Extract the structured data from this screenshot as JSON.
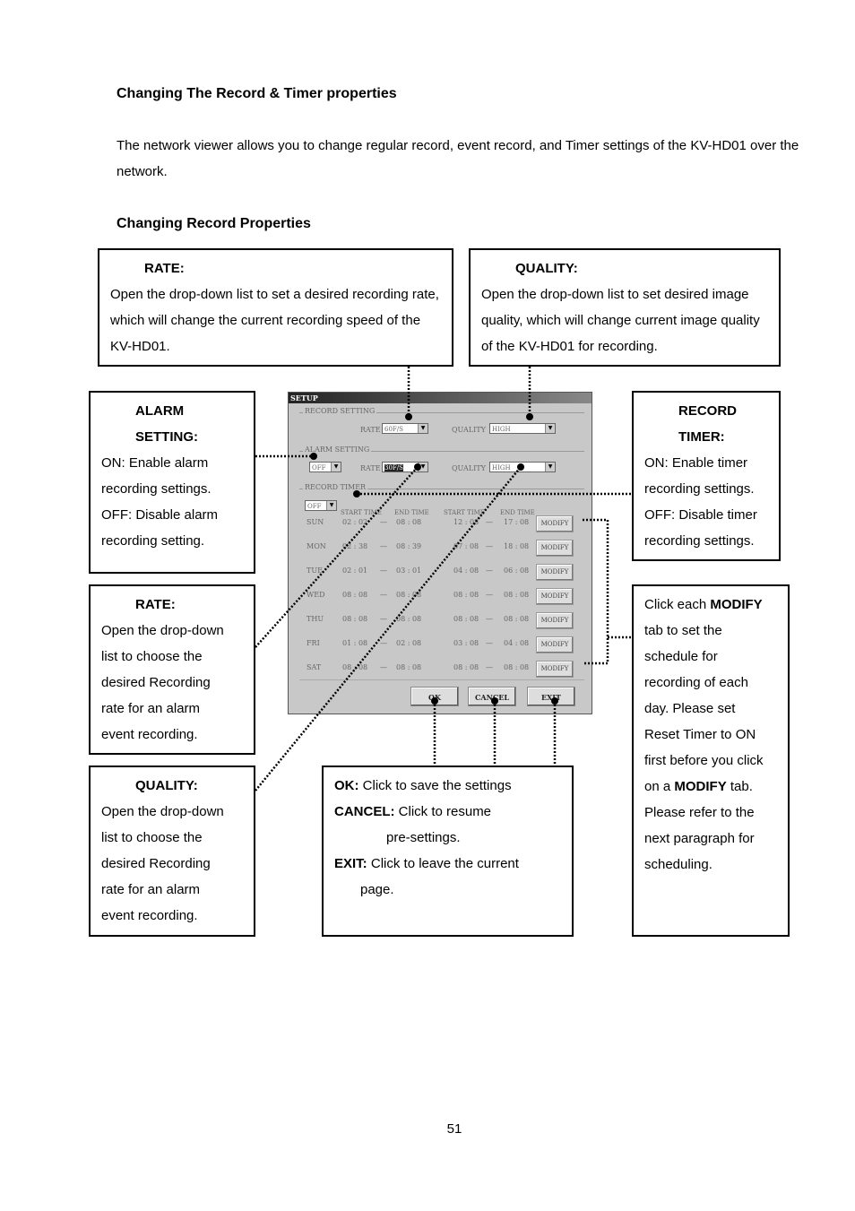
{
  "heading1": "Changing The Record & Timer properties",
  "intro": "The network viewer allows you to change regular record, event record, and Timer settings of the KV-HD01 over the network.",
  "heading2": "Changing Record Properties",
  "callouts": {
    "rate_top": {
      "title": "RATE:",
      "body": "Open the drop-down list to set a desired recording rate, which will change the current recording speed of the KV-HD01."
    },
    "quality_top": {
      "title": "QUALITY:",
      "body": "Open the drop-down list to set desired image quality, which will change current image quality of the KV-HD01 for recording."
    },
    "alarm": {
      "title1": "ALARM",
      "title2": "SETTING:",
      "line1": "ON: Enable alarm",
      "line2": "recording settings.",
      "line3": "OFF: Disable alarm",
      "line4": "recording setting."
    },
    "record_timer": {
      "title1": "RECORD",
      "title2": "TIMER:",
      "line1": "ON: Enable timer",
      "line2": "recording settings.",
      "line3": "OFF: Disable timer",
      "line4": "recording settings."
    },
    "rate_alarm": {
      "title": "RATE:",
      "lines": [
        "Open the drop-down",
        "list to choose the",
        "desired Recording",
        "rate for an alarm",
        "event recording."
      ]
    },
    "quality_alarm": {
      "title": "QUALITY:",
      "lines": [
        "Open the drop-down",
        "list to choose the",
        "desired Recording",
        "rate for an alarm",
        "event recording."
      ]
    },
    "buttons": {
      "ok_key": "OK:",
      "ok_text": " Click to save the settings",
      "cancel_key": "CANCEL:",
      "cancel_text": " Click to resume",
      "cancel_text2": "pre-settings.",
      "exit_key": "EXIT:",
      "exit_text": " Click to leave the current",
      "exit_text2": "page."
    },
    "modify": {
      "l1a": "Click each ",
      "l1b": "MODIFY",
      "l2": "tab to set the",
      "l3": "schedule for",
      "l4": "recording of each",
      "l5": "day. Please set",
      "l6": "Reset Timer to ON",
      "l7": "first before you click",
      "l8a": "on a ",
      "l8b": "MODIFY",
      "l8c": " tab.",
      "l9": "Please refer to the",
      "l10": "next paragraph for",
      "l11": "scheduling."
    }
  },
  "dialog": {
    "title": "SETUP",
    "record_setting": {
      "label": "RECORD SETTING",
      "rate_label": "RATE",
      "rate_value": "60F/S",
      "quality_label": "QUALITY",
      "quality_value": "HIGH"
    },
    "alarm_setting": {
      "label": "ALARM SETTING",
      "state": "OFF",
      "rate_label": "RATE",
      "rate_value": "30F/S",
      "quality_label": "QUALITY",
      "quality_value": "HIGH"
    },
    "record_timer": {
      "label": "RECORD TIMER",
      "state": "OFF",
      "col_start1": "START TIME",
      "col_end1": "END TIME",
      "col_start2": "START TIME",
      "col_end2": "END TIME",
      "modify_label": "MODIFY"
    },
    "schedule": [
      {
        "day": "SUN",
        "s1": "02 : 02",
        "e1": "08 : 08",
        "s2": "12 : 08",
        "e2": "17 : 08"
      },
      {
        "day": "MON",
        "s1": "02 : 38",
        "e1": "08 : 39",
        "s2": "07 : 08",
        "e2": "18 : 08"
      },
      {
        "day": "TUE",
        "s1": "02 : 01",
        "e1": "03 : 01",
        "s2": "04 : 08",
        "e2": "06 : 08"
      },
      {
        "day": "WED",
        "s1": "08 : 08",
        "e1": "08 : 08",
        "s2": "08 : 08",
        "e2": "08 : 08"
      },
      {
        "day": "THU",
        "s1": "08 : 08",
        "e1": "08 : 08",
        "s2": "08 : 08",
        "e2": "08 : 08"
      },
      {
        "day": "FRI",
        "s1": "01 : 08",
        "e1": "02 : 08",
        "s2": "03 : 08",
        "e2": "04 : 08"
      },
      {
        "day": "SAT",
        "s1": "08 : 08",
        "e1": "08 : 08",
        "s2": "08 : 08",
        "e2": "08 : 08"
      }
    ],
    "ok": "OK",
    "cancel": "CANCEL",
    "exit": "EXIT"
  },
  "page_number": "51"
}
